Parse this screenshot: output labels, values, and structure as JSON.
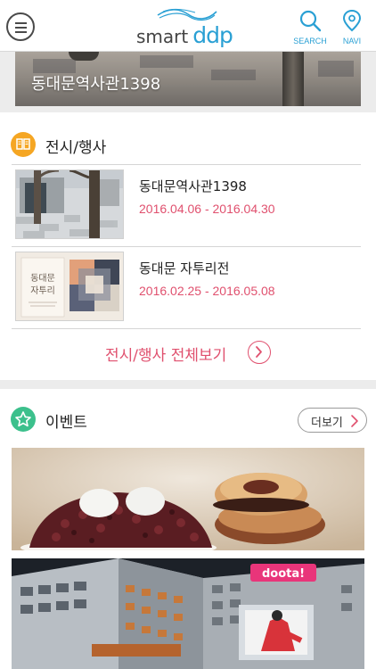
{
  "header": {
    "menu_icon": "hamburger-menu-icon",
    "logo": {
      "prefix": "smart",
      "brand": "ddp"
    },
    "search_label": "SEARCH",
    "navi_label": "NAVI",
    "accent_color": "#2aa0d4"
  },
  "banner": {
    "title": "동대문역사관1398"
  },
  "exhibitions": {
    "title": "전시/행사",
    "icon": "book-icon",
    "icon_color": "#f5a623",
    "items": [
      {
        "title": "동대문역사관1398",
        "date": "2016.04.06  -  2016.04.30"
      },
      {
        "title": "동대문 자투리전",
        "date": "2016.02.25  -  2016.05.08"
      }
    ],
    "view_all": "전시/행사 전체보기",
    "accent_color": "#e0506e"
  },
  "events": {
    "title": "이벤트",
    "icon": "star-icon",
    "icon_color": "#3cc08c",
    "more_label": "더보기"
  },
  "thumb_text": {
    "poster_title_line1": "동대문",
    "poster_title_line2": "자투리"
  },
  "event_sign": "doota!"
}
